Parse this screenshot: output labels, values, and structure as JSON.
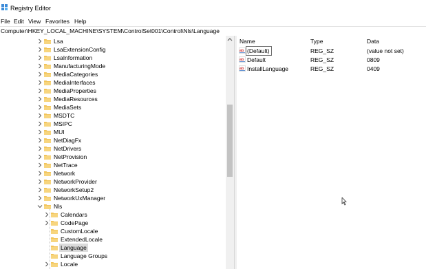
{
  "window": {
    "title": "Registry Editor"
  },
  "menu": [
    "File",
    "Edit",
    "View",
    "Favorites",
    "Help"
  ],
  "address": "Computer\\HKEY_LOCAL_MACHINE\\SYSTEM\\ControlSet001\\Control\\Nls\\Language",
  "tree": [
    {
      "label": "Lsa",
      "level": 0,
      "chevron": "right"
    },
    {
      "label": "LsaExtensionConfig",
      "level": 0,
      "chevron": "right"
    },
    {
      "label": "LsaInformation",
      "level": 0,
      "chevron": "right"
    },
    {
      "label": "ManufacturingMode",
      "level": 0,
      "chevron": "right"
    },
    {
      "label": "MediaCategories",
      "level": 0,
      "chevron": "right"
    },
    {
      "label": "MediaInterfaces",
      "level": 0,
      "chevron": "right"
    },
    {
      "label": "MediaProperties",
      "level": 0,
      "chevron": "right"
    },
    {
      "label": "MediaResources",
      "level": 0,
      "chevron": "right"
    },
    {
      "label": "MediaSets",
      "level": 0,
      "chevron": "right"
    },
    {
      "label": "MSDTC",
      "level": 0,
      "chevron": "right"
    },
    {
      "label": "MSIPC",
      "level": 0,
      "chevron": "right"
    },
    {
      "label": "MUI",
      "level": 0,
      "chevron": "right"
    },
    {
      "label": "NetDiagFx",
      "level": 0,
      "chevron": "right"
    },
    {
      "label": "NetDrivers",
      "level": 0,
      "chevron": "right"
    },
    {
      "label": "NetProvision",
      "level": 0,
      "chevron": "right"
    },
    {
      "label": "NetTrace",
      "level": 0,
      "chevron": "right"
    },
    {
      "label": "Network",
      "level": 0,
      "chevron": "right"
    },
    {
      "label": "NetworkProvider",
      "level": 0,
      "chevron": "right"
    },
    {
      "label": "NetworkSetup2",
      "level": 0,
      "chevron": "right"
    },
    {
      "label": "NetworkUxManager",
      "level": 0,
      "chevron": "right"
    },
    {
      "label": "Nls",
      "level": 0,
      "chevron": "down"
    },
    {
      "label": "Calendars",
      "level": 1,
      "chevron": "right"
    },
    {
      "label": "CodePage",
      "level": 1,
      "chevron": "right"
    },
    {
      "label": "CustomLocale",
      "level": 1,
      "chevron": "none"
    },
    {
      "label": "ExtendedLocale",
      "level": 1,
      "chevron": "none"
    },
    {
      "label": "Language",
      "level": 1,
      "chevron": "none",
      "selected": true
    },
    {
      "label": "Language Groups",
      "level": 1,
      "chevron": "none"
    },
    {
      "label": "Locale",
      "level": 1,
      "chevron": "right"
    }
  ],
  "list": {
    "headers": {
      "name": "Name",
      "type": "Type",
      "data": "Data"
    },
    "rows": [
      {
        "name": "(Default)",
        "type": "REG_SZ",
        "data": "(value not set)"
      },
      {
        "name": "Default",
        "type": "REG_SZ",
        "data": "0809"
      },
      {
        "name": "InstallLanguage",
        "type": "REG_SZ",
        "data": "0409"
      }
    ]
  },
  "icons": {
    "app": "registry-editor-icon",
    "folder": "folder-icon",
    "value": "string-value-icon",
    "chevron_right": "chevron-right-icon",
    "chevron_down": "chevron-down-icon"
  },
  "colors": {
    "folder": "#f2c45a",
    "value_icon": "#d23b3b",
    "selection": "#dadada"
  }
}
